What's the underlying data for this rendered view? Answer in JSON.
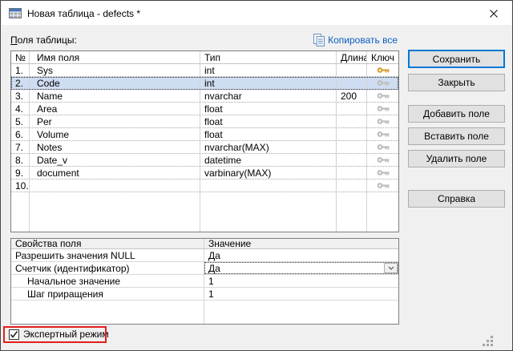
{
  "window": {
    "title": "Новая таблица - defects *"
  },
  "fields_section": {
    "label_first": "П",
    "label_rest": "оля таблицы:",
    "copy_all_link": "Копировать все",
    "table": {
      "columns": [
        "№",
        "Имя поля",
        "Тип",
        "Длина",
        "Ключ"
      ],
      "selected_row_index": 1,
      "rows": [
        {
          "num": "1.",
          "name": "Sys",
          "type": "int",
          "length": "",
          "key": "primary"
        },
        {
          "num": "2.",
          "name": "Code",
          "type": "int",
          "length": "",
          "key": "none"
        },
        {
          "num": "3.",
          "name": "Name",
          "type": "nvarchar",
          "length": "200",
          "key": "none"
        },
        {
          "num": "4.",
          "name": "Area",
          "type": "float",
          "length": "",
          "key": "none"
        },
        {
          "num": "5.",
          "name": "Per",
          "type": "float",
          "length": "",
          "key": "none"
        },
        {
          "num": "6.",
          "name": "Volume",
          "type": "float",
          "length": "",
          "key": "none"
        },
        {
          "num": "7.",
          "name": "Notes",
          "type": "nvarchar(MAX)",
          "length": "",
          "key": "none"
        },
        {
          "num": "8.",
          "name": "Date_v",
          "type": "datetime",
          "length": "",
          "key": "none"
        },
        {
          "num": "9.",
          "name": "document",
          "type": "varbinary(MAX)",
          "length": "",
          "key": "none"
        },
        {
          "num": "10.",
          "name": "",
          "type": "",
          "length": "",
          "key": "none"
        }
      ]
    }
  },
  "buttons": {
    "save": "Сохранить",
    "close": "Закрыть",
    "add_field": "Добавить поле",
    "insert_field": "Вставить поле",
    "delete_field": "Удалить поле",
    "help": "Справка"
  },
  "properties_section": {
    "columns": [
      "Свойства поля",
      "Значение"
    ],
    "rows": [
      {
        "label": "Разрешить значения NULL",
        "value": "Да"
      },
      {
        "label": "Счетчик (идентификатор)",
        "value": "Да",
        "has_dropdown": true,
        "focused": true
      },
      {
        "label": "Начальное значение",
        "value": "1",
        "indent": true
      },
      {
        "label": "Шаг приращения",
        "value": "1",
        "indent": true
      }
    ]
  },
  "footer": {
    "expert_mode_label": "Экспертный режим",
    "expert_mode_checked": true
  },
  "colors": {
    "selection": "#cfddf2",
    "default_button_border": "#0078d7",
    "link": "#0a5dc2",
    "primary_key": "#d9a233",
    "annotation": "#e0201c"
  }
}
